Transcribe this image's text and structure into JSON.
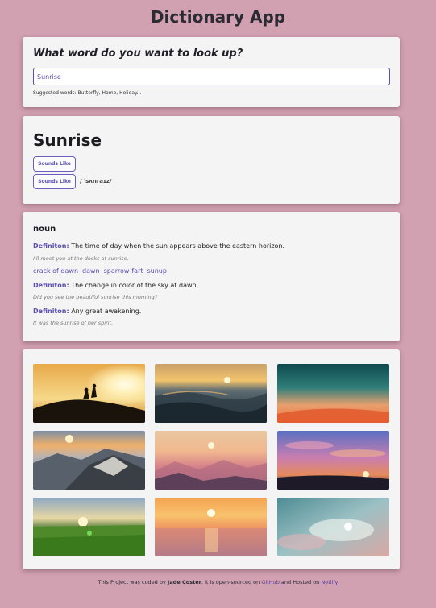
{
  "app": {
    "title": "Dictionary App"
  },
  "search": {
    "question": "What word do you want to look up?",
    "value": "Sunrise",
    "hint": "Suggested words: Butterfly, Home, Holiday..."
  },
  "word": {
    "title": "Sunrise",
    "sounds_like_1": "Sounds Like",
    "sounds_like_2": "Sounds Like",
    "phonetic": "/ ˈsʌnraɪz/"
  },
  "meaning": {
    "part_of_speech": "noun",
    "definition_label": "Definiton:",
    "definitions": [
      {
        "text": "The time of day when the sun appears above the eastern horizon.",
        "example": "I'll meet you at the docks at sunrise."
      },
      {
        "text": "The change in color of the sky at dawn.",
        "example": "Did you see the beautiful sunrise this morning?"
      },
      {
        "text": "Any great awakening.",
        "example": "It was the sunrise of her spirit."
      }
    ],
    "synonyms": [
      "crack of dawn",
      "dawn",
      "sparrow-fart",
      "sunup"
    ]
  },
  "photos": [
    {
      "name": "photo-silhouettes-hill-sunrise"
    },
    {
      "name": "photo-ocean-waves-sunrise"
    },
    {
      "name": "photo-teal-sky-sunrise"
    },
    {
      "name": "photo-mountain-valley-sunrise"
    },
    {
      "name": "photo-pink-mountains-sunrise"
    },
    {
      "name": "photo-purple-clouds-sunrise"
    },
    {
      "name": "photo-green-field-sunrise"
    },
    {
      "name": "photo-orange-sea-sunrise"
    },
    {
      "name": "photo-cloudy-sky-sunrise"
    }
  ],
  "footer": {
    "text1": "This Project was coded by ",
    "author": "Jade Coster",
    "text2": ". It is open-sourced on ",
    "github": "GitHub",
    "text3": " and Hosted on ",
    "netlify": "Netlify"
  },
  "colors": {
    "background": "#d1a0b1",
    "accent": "#5b4fb0",
    "card": "#f4f4f5"
  }
}
